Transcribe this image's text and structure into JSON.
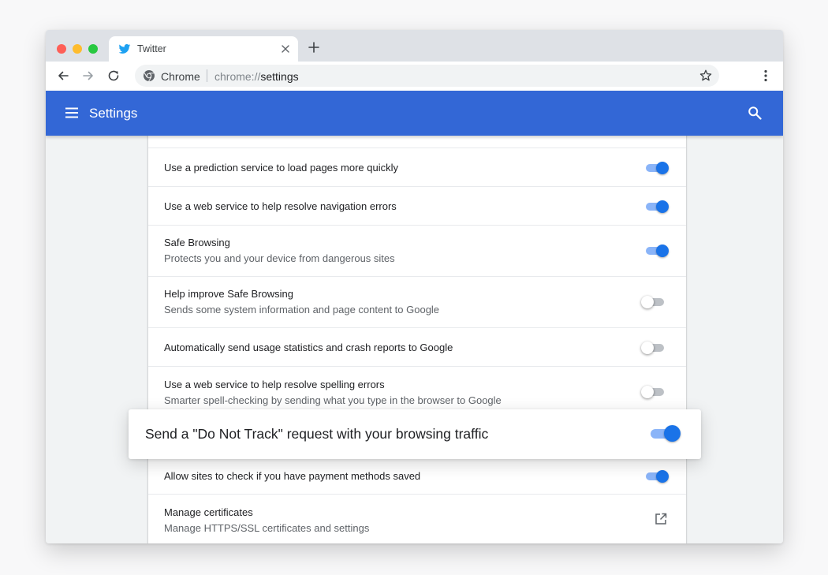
{
  "browser": {
    "tab": {
      "title": "Twitter"
    },
    "omnibox": {
      "scheme_label": "Chrome",
      "url_prefix": "chrome://",
      "url_path": "settings"
    }
  },
  "header": {
    "title": "Settings"
  },
  "settings_rows": [
    {
      "title": "Use a prediction service to load pages more quickly",
      "enabled": true
    },
    {
      "title": "Use a web service to help resolve navigation errors",
      "enabled": true
    },
    {
      "title": "Safe Browsing",
      "subtitle": "Protects you and your device from dangerous sites",
      "enabled": true
    },
    {
      "title": "Help improve Safe Browsing",
      "subtitle": "Sends some system information and page content to Google",
      "enabled": false
    },
    {
      "title": "Automatically send usage statistics and crash reports to Google",
      "enabled": false
    },
    {
      "title": "Use a web service to help resolve spelling errors",
      "subtitle": "Smarter spell-checking by sending what you type in the browser to Google",
      "enabled": false
    },
    {
      "title": "Allow sites to check if you have payment methods saved",
      "enabled": true
    },
    {
      "title": "Manage certificates",
      "subtitle": "Manage HTTPS/SSL certificates and settings"
    }
  ],
  "highlight": {
    "title": "Send a \"Do Not Track\" request with your browsing traffic",
    "enabled": true
  },
  "colors": {
    "header_blue": "#3367d6",
    "toggle_on": "#1a73e8",
    "toggle_track_on": "#8ab4f8"
  },
  "icons": [
    "twitter-icon",
    "close-icon",
    "new-tab-icon",
    "back-icon",
    "forward-icon",
    "reload-icon",
    "chrome-icon",
    "star-icon",
    "menu-dots-icon",
    "hamburger-icon",
    "search-icon",
    "open-in-new-icon"
  ]
}
